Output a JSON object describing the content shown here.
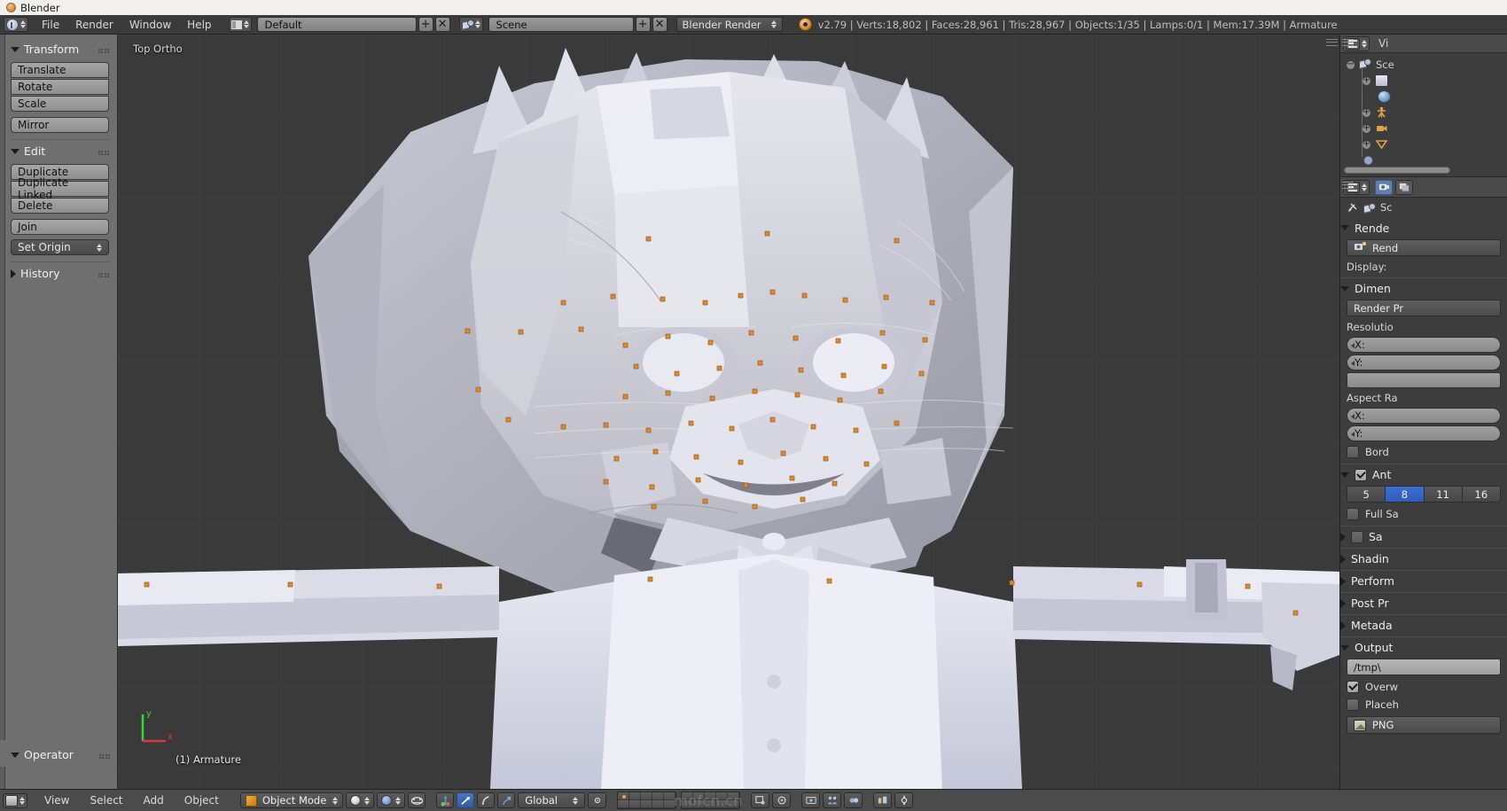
{
  "window": {
    "title": "Blender",
    "app_icon": "blender-logo-icon"
  },
  "topbar": {
    "editor_type_icon": "info-editor-icon",
    "menus": [
      {
        "label": "File"
      },
      {
        "label": "Render"
      },
      {
        "label": "Window"
      },
      {
        "label": "Help"
      }
    ],
    "screen_layout": {
      "icon": "screen-layout-icon",
      "value": "Default",
      "add": "+",
      "remove": "✕"
    },
    "scene": {
      "icon": "scene-icon",
      "value": "Scene",
      "add": "+",
      "remove": "✕"
    },
    "render_engine": {
      "value": "Blender Render"
    },
    "status": {
      "version": "v2.79",
      "verts": "Verts:18,802",
      "faces": "Faces:28,961",
      "tris": "Tris:28,967",
      "objects": "Objects:1/35",
      "lamps": "Lamps:0/1",
      "mem": "Mem:17.39M",
      "active_object": "Armature",
      "full": "v2.79 | Verts:18,802 | Faces:28,961 | Tris:28,967 | Objects:1/35 | Lamps:0/1 | Mem:17.39M | Armature"
    }
  },
  "toolshelf": {
    "panels": [
      {
        "title": "Transform",
        "collapsed": false,
        "buttons": [
          "Translate",
          "Rotate",
          "Scale",
          "Mirror"
        ]
      },
      {
        "title": "Edit",
        "collapsed": false,
        "buttons": [
          "Duplicate",
          "Duplicate Linked",
          "Delete",
          "Join"
        ],
        "dropdown": "Set Origin"
      },
      {
        "title": "History",
        "collapsed": true,
        "buttons": []
      }
    ],
    "operator_panel": {
      "title": "Operator"
    }
  },
  "viewport": {
    "view_label": "Top Ortho",
    "object_label": "(1) Armature",
    "axis_x": "x",
    "axis_y": "y",
    "background_color": "#3a3a3a",
    "selection_color": "#e08a2e",
    "mesh_color": "#cfcfd8"
  },
  "outliner": {
    "display_mode_icon": "outliner-icon",
    "display_mode": "Vi",
    "rows": [
      {
        "label": "Sce",
        "icon": "scene-icon",
        "expand": "−"
      },
      {
        "label": "",
        "icon": "render-layers-icon",
        "expand": "+"
      },
      {
        "label": "",
        "icon": "world-icon",
        "expand": ""
      },
      {
        "label": "",
        "icon": "armature-icon",
        "expand": "+"
      },
      {
        "label": "",
        "icon": "camera-icon",
        "expand": "+"
      },
      {
        "label": "",
        "icon": "lamp-icon",
        "expand": "+"
      },
      {
        "label": "",
        "icon": "mesh-icon",
        "expand": "+"
      }
    ]
  },
  "properties": {
    "tabs": [
      {
        "name": "render-tab",
        "icon": "camera-back-icon",
        "active": true
      },
      {
        "name": "render-layers-tab",
        "icon": "render-layers-icon",
        "active": false
      }
    ],
    "breadcrumb": {
      "pin_icon": "pin-icon",
      "scene_icon": "scene-icon",
      "scene_label": "Sc"
    },
    "sections": [
      {
        "title": "Rende",
        "expanded": true,
        "type": "render"
      },
      {
        "title": "Dimen",
        "expanded": true,
        "type": "dimensions"
      },
      {
        "title": "Ant",
        "expanded": true,
        "type": "antialiasing",
        "checkbox": true
      },
      {
        "title": "Sa",
        "expanded": false,
        "type": "sampled-motion-blur",
        "checkbox": true
      },
      {
        "title": "Shadin",
        "expanded": false,
        "type": "shading"
      },
      {
        "title": "Perform",
        "expanded": false,
        "type": "performance"
      },
      {
        "title": "Post Pr",
        "expanded": false,
        "type": "post-processing"
      },
      {
        "title": "Metada",
        "expanded": false,
        "type": "metadata"
      },
      {
        "title": "Output",
        "expanded": true,
        "type": "output"
      }
    ],
    "render": {
      "button": "Rend",
      "display_label": "Display:"
    },
    "dimensions": {
      "preset": "Render Pr",
      "resolution_label": "Resolutio",
      "res_x": "X:",
      "res_y": "Y:",
      "percent": "",
      "aspect_label": "Aspect Ra",
      "asp_x": "X:",
      "asp_y": "Y:",
      "border": "Bord"
    },
    "antialiasing": {
      "samples": [
        "5",
        "8",
        "11",
        "16"
      ],
      "selected_sample": "8",
      "full_sample": "Full Sa"
    },
    "output": {
      "path": "/tmp\\",
      "overwrite": "Overw",
      "overwrite_checked": true,
      "placeholders": "Placeh",
      "placeholders_checked": false,
      "file_format": "PNG"
    }
  },
  "bottombar": {
    "editor_icon": "3dview-editor-icon",
    "menus": [
      {
        "label": "View"
      },
      {
        "label": "Select"
      },
      {
        "label": "Add"
      },
      {
        "label": "Object"
      }
    ],
    "mode": "Object Mode",
    "viewport_shading": "solid-shading-icon",
    "transform_orientation": "Global",
    "snap_icon": "magnet-icon",
    "manipulator_icons": [
      "translate-manipulator-icon",
      "rotate-manipulator-icon",
      "scale-manipulator-icon"
    ],
    "layers": {
      "row1_active_index": 0,
      "count_per_row": 5,
      "blocks": 2
    },
    "extra_icons": [
      "proportional-edit-icon",
      "render-preview-icon",
      "lock-icon",
      "people-icon",
      "group-icon",
      "tools-icon"
    ],
    "watermark": "mofcn.cn"
  },
  "colors": {
    "accent_blue": "#3b6fd4",
    "selection_orange": "#e08a2e",
    "panel_gray": "#6f6f6f",
    "header_gray": "#4b4b4b",
    "viewport_bg": "#3a3a3a",
    "props_bg": "#3d3d3d",
    "titlebar": "#f2f0ee"
  }
}
